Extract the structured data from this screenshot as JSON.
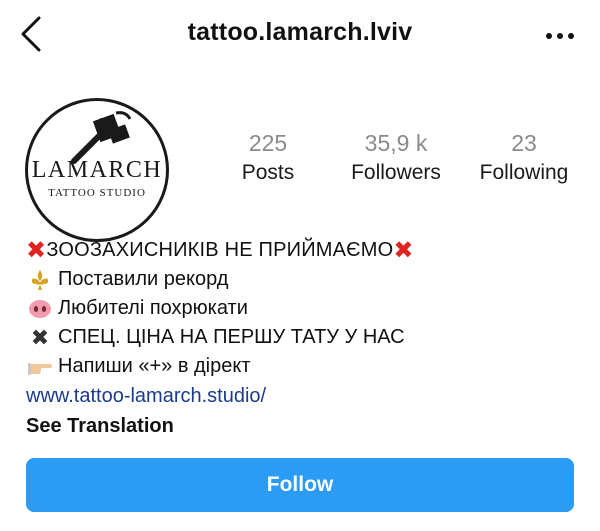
{
  "header": {
    "username": "tattoo.lamarch.lviv",
    "back_icon": "chevron-left-icon",
    "more_icon": "more-horizontal-icon"
  },
  "profile": {
    "avatar": {
      "brand_name": "LAMARCH",
      "brand_sub": "TATTOO STUDIO"
    },
    "stats": [
      {
        "value": "225",
        "label": "Posts"
      },
      {
        "value": "35,9 k",
        "label": "Followers"
      },
      {
        "value": "23",
        "label": "Following"
      }
    ]
  },
  "bio": {
    "title": "ЗООЗАХИСНИКІВ НЕ ПРИЙМАЄМО",
    "lines": [
      {
        "icon": "fleur-de-lis-icon",
        "text": "Поставили рекорд"
      },
      {
        "icon": "pig-nose-icon",
        "text": "Любителі похрюкати"
      },
      {
        "icon": "cross-mark-icon",
        "text": "СПЕЦ. ЦІНА НА ПЕРШУ ТАТУ У НАС"
      },
      {
        "icon": "pointing-hand-icon",
        "text": "Напиши «+» в дірект"
      }
    ],
    "website": "www.tattoo-lamarch.studio/",
    "see_translation": "See Translation"
  },
  "actions": {
    "follow_label": "Follow"
  },
  "colors": {
    "accent": "#2b9bf4",
    "link": "#1b3c8c",
    "red_x": "#e0241f",
    "stat_number": "#8a8a8a"
  }
}
